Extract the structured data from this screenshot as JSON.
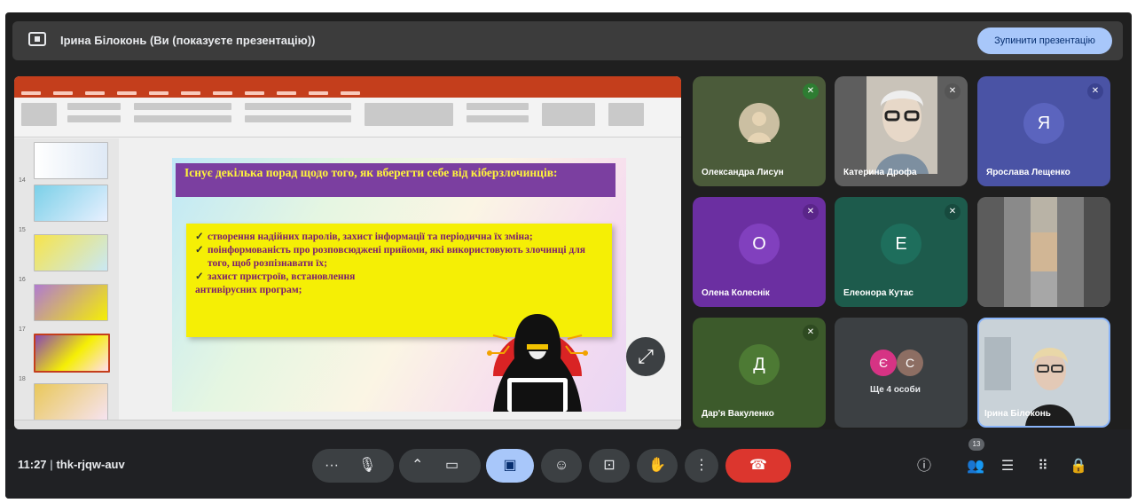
{
  "top_bar": {
    "title": "Ірина Білоконь (Ви (показуєте презентацію))",
    "stop_button": "Зупинити презентацію"
  },
  "slide": {
    "heading": "Існує декілька порад щодо того, як вберегти себе від кіберзлочинців:",
    "bullets": [
      "створення надійних паролів, захист інформації та періодична їх зміна;",
      "поінформованість про розповсюджені прийоми, які використовують злочинці для того, щоб розпізнавати їх;",
      "захист пристроїв, встановлення"
    ],
    "bullet_tail": "антивірусних програм;"
  },
  "participants": [
    {
      "name": "Олександра Лисун",
      "type": "photo",
      "muted": true,
      "bg": "#4b5b3a"
    },
    {
      "name": "Катерина Дрофа",
      "type": "video",
      "muted": true,
      "bg": "#5a5a5a"
    },
    {
      "name": "Ярослава Лещенко",
      "initial": "Я",
      "muted": true,
      "bg": "#4a53a5",
      "avatar": "#5b64be"
    },
    {
      "name": "Олена Колеснік",
      "initial": "О",
      "muted": true,
      "bg": "#6b2fa1",
      "avatar": "#8140be"
    },
    {
      "name": "Елеонора Кутас",
      "initial": "Е",
      "muted": true,
      "bg": "#1d5b4c",
      "avatar": "#1e6e5c"
    },
    {
      "name": "",
      "type": "blurred",
      "bg": "#6e6e6e"
    },
    {
      "name": "Дар'я Вакуленко",
      "initial": "Д",
      "muted": true,
      "bg": "#3c5a2b",
      "avatar": "#4d7a34"
    },
    {
      "name": "Ще 4 особи",
      "type": "group",
      "initials": [
        "Є",
        "С"
      ]
    },
    {
      "name": "Ірина Білоконь",
      "type": "self"
    }
  ],
  "bottom_bar": {
    "time": "11:27",
    "separator": "|",
    "meeting_code": "thk-rjqw-auv",
    "people_count": "13"
  },
  "icons": [
    "present-icon",
    "mic-icon",
    "more-icon",
    "chevron-up-icon",
    "camera-icon",
    "present-screen-icon",
    "emoji-icon",
    "captions-icon",
    "raise-hand-icon",
    "more-vert-icon",
    "end-call-icon",
    "info-icon",
    "people-icon",
    "chat-icon",
    "apps-icon",
    "lock-icon",
    "expand-icon",
    "mic-off-icon"
  ]
}
